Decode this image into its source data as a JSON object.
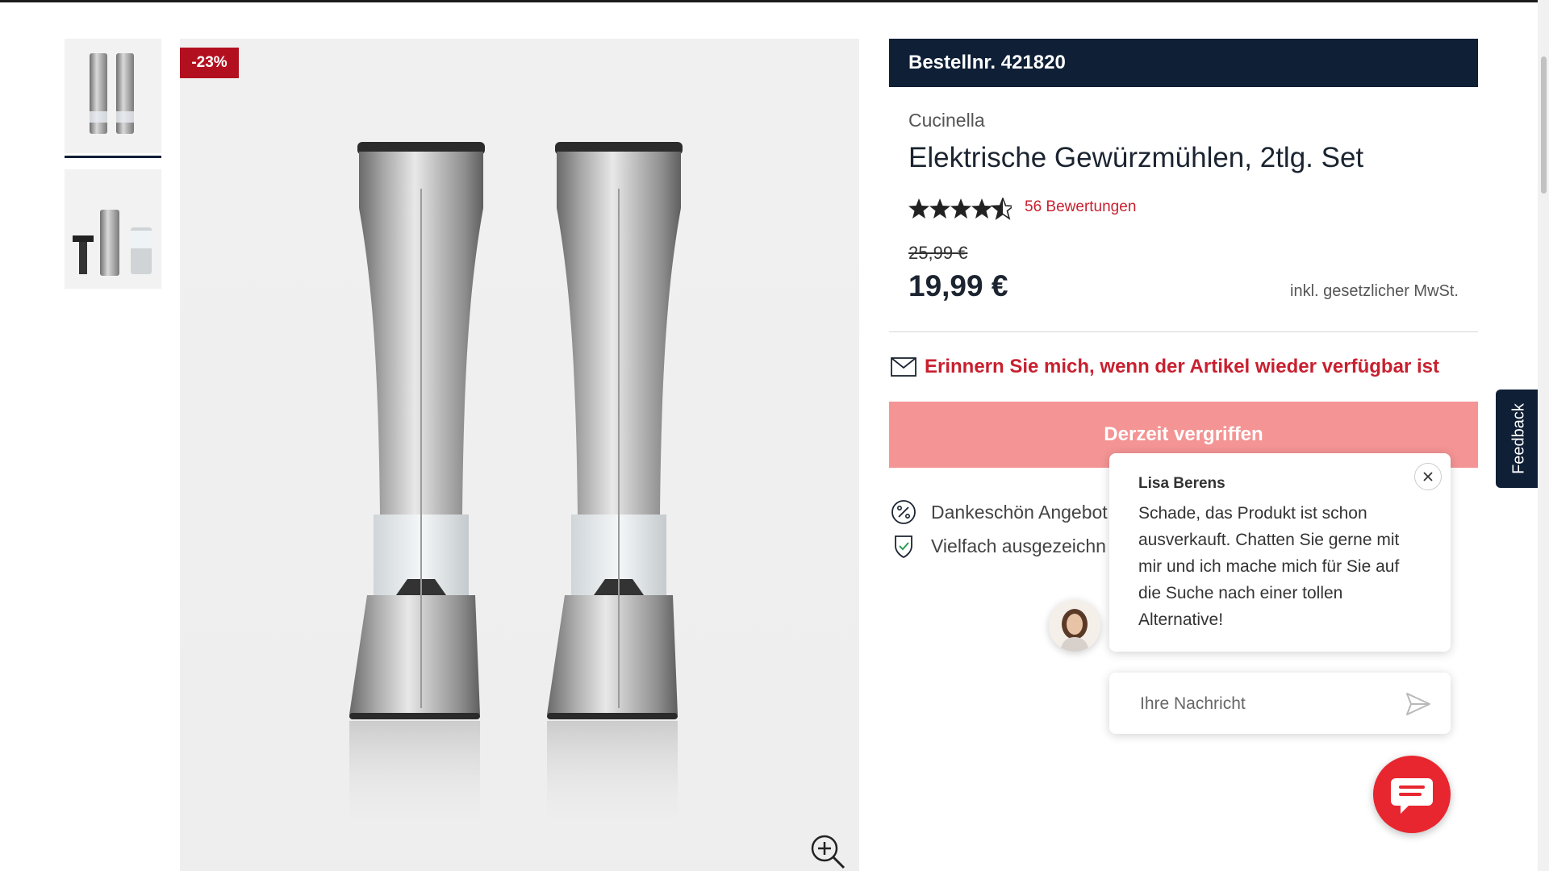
{
  "product": {
    "discount_badge": "-23%",
    "order_number": "Bestellnr. 421820",
    "brand": "Cucinella",
    "title": "Elektrische Gewürzmühlen, 2tlg. Set",
    "rating": 4.5,
    "rating_max": 5,
    "reviews_label": "56 Bewertungen",
    "old_price": "25,99 €",
    "price": "19,99 €",
    "vat_note": "inkl. gesetzlicher MwSt.",
    "remind_label": "Erinnern Sie mich, wenn der Artikel wieder verfügbar ist",
    "soldout_label": "Derzeit vergriffen",
    "usps": [
      "Dankeschön Angebot",
      "Vielfach ausgezeichn"
    ],
    "thumbnails": [
      "mill-pair-thumbnail",
      "mill-set-parts-thumbnail"
    ],
    "selected_thumbnail": 0
  },
  "feedback_tab": {
    "label": "Feedback"
  },
  "chat": {
    "agent_name": "Lisa Berens",
    "message": "Schade, das Produkt ist schon ausverkauft. Chatten Sie gerne mit mir und ich mache mich für Sie auf die Suche nach einer tollen Alternative!",
    "input_placeholder": "Ihre Nachricht"
  },
  "colors": {
    "navy": "#0e1f36",
    "accent_red": "#c8202f",
    "badge_red": "#b3101f",
    "soldout_pink": "#f49494",
    "chat_red": "#e8262f"
  },
  "icons": [
    "zoom-in-icon",
    "mail-icon",
    "percent-icon",
    "shield-check-icon",
    "close-icon",
    "send-icon",
    "chat-bubble-icon",
    "star-icon"
  ]
}
